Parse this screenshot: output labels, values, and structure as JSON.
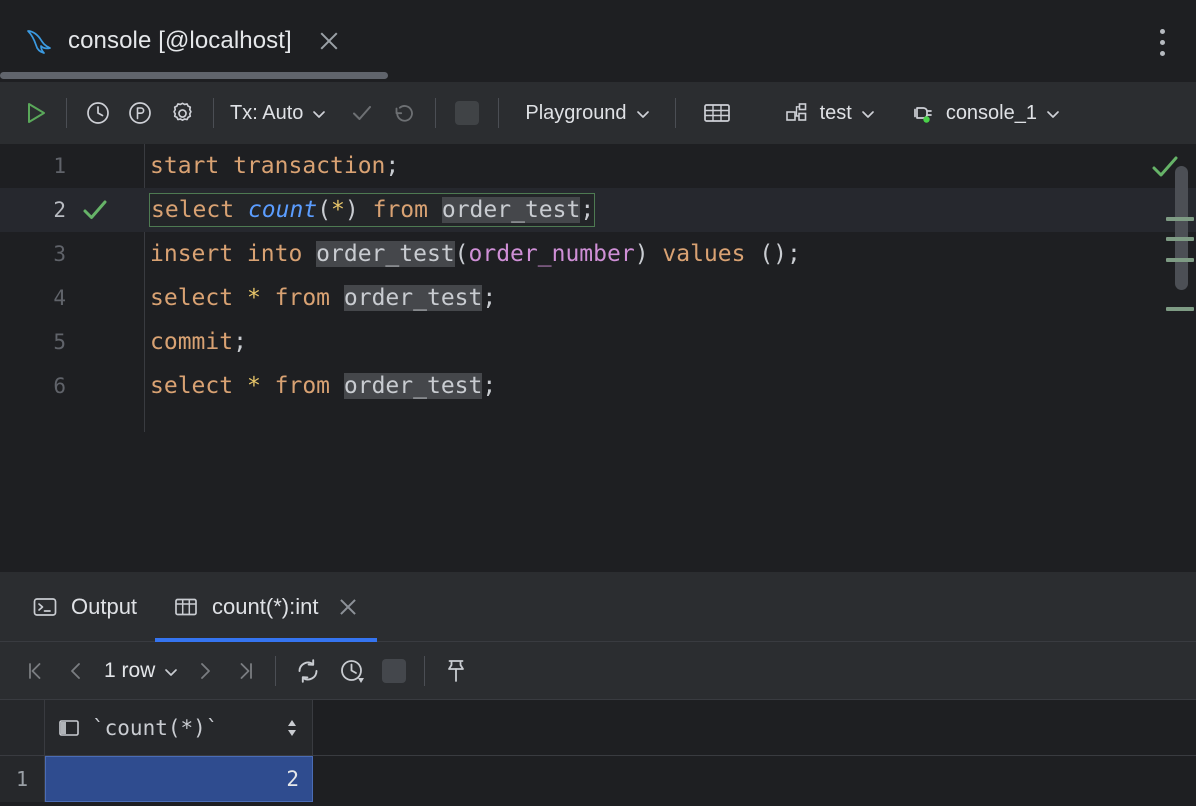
{
  "window": {
    "tab_title": "console [@localhost]",
    "tab_icon": "mysql-dolphin-icon",
    "close_icon": "close-icon",
    "menu_icon": "vertical-dots-icon"
  },
  "toolbar": {
    "run_label": "execute-icon",
    "history_label": "history-clock-icon",
    "params_label": "parameters-icon",
    "settings_label": "gear-icon",
    "tx_label": "Tx: Auto",
    "commit_label": "commit-check-icon",
    "rollback_label": "rollback-icon",
    "stop_label": "stop-icon",
    "playground_label": "Playground",
    "table_editor_label": "table-icon",
    "schema_label": "test",
    "session_label": "console_1",
    "connected": true,
    "accent_green": "#62b162",
    "accent_blue": "#3574f0"
  },
  "editor": {
    "current_line": 2,
    "lines": [
      {
        "num": "1",
        "tokens": [
          {
            "t": "start transaction",
            "c": "kw"
          },
          {
            "t": ";",
            "c": "punct"
          }
        ]
      },
      {
        "num": "2",
        "boxed": true,
        "tokens": [
          {
            "t": "select ",
            "c": "kw"
          },
          {
            "t": "count",
            "c": "fn"
          },
          {
            "t": "(",
            "c": "punct"
          },
          {
            "t": "*",
            "c": "star"
          },
          {
            "t": ") ",
            "c": "punct"
          },
          {
            "t": "from ",
            "c": "kw"
          },
          {
            "t": "order_test",
            "c": "tbl"
          },
          {
            "t": ";",
            "c": "punct"
          }
        ]
      },
      {
        "num": "3",
        "tokens": [
          {
            "t": "insert into ",
            "c": "kw"
          },
          {
            "t": "order_test",
            "c": "tbl"
          },
          {
            "t": "(",
            "c": "punct"
          },
          {
            "t": "order_number",
            "c": "col"
          },
          {
            "t": ") ",
            "c": "punct"
          },
          {
            "t": "values ",
            "c": "kw"
          },
          {
            "t": "();",
            "c": "punct"
          }
        ]
      },
      {
        "num": "4",
        "tokens": [
          {
            "t": "select ",
            "c": "kw"
          },
          {
            "t": "*",
            "c": "star"
          },
          {
            "t": " from ",
            "c": "kw"
          },
          {
            "t": "order_test",
            "c": "tbl"
          },
          {
            "t": ";",
            "c": "punct"
          }
        ]
      },
      {
        "num": "5",
        "tokens": [
          {
            "t": "commit",
            "c": "kw"
          },
          {
            "t": ";",
            "c": "punct"
          }
        ]
      },
      {
        "num": "6",
        "tokens": [
          {
            "t": "select ",
            "c": "kw"
          },
          {
            "t": "*",
            "c": "star"
          },
          {
            "t": " from ",
            "c": "kw"
          },
          {
            "t": "order_test",
            "c": "tbl"
          },
          {
            "t": ";",
            "c": "punct"
          }
        ]
      }
    ]
  },
  "results": {
    "tabs": [
      {
        "label": "Output",
        "icon": "terminal-icon",
        "active": false,
        "closable": false
      },
      {
        "label": "count(*):int",
        "icon": "grid-table-icon",
        "active": true,
        "closable": true
      }
    ],
    "toolbar": {
      "first_page": "first-page-icon",
      "prev_page": "prev-page-icon",
      "row_count": "1 row",
      "next_page": "next-page-icon",
      "last_page": "last-page-icon",
      "reload": "reload-icon",
      "history": "query-history-icon",
      "stop": "stop-icon",
      "pin": "pin-tab-icon"
    },
    "grid": {
      "columns": [
        "`count(*)`"
      ],
      "rows": [
        {
          "num": "1",
          "cells": [
            "2"
          ]
        }
      ],
      "selection_color": "#2f4c8f"
    }
  }
}
